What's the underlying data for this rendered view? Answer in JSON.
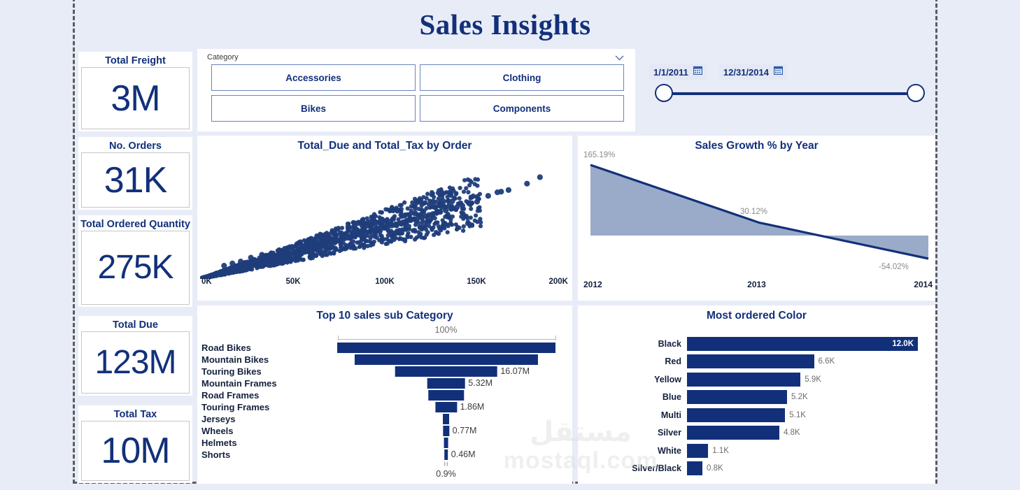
{
  "page": {
    "title": "Sales Insights",
    "background": "#e8ecf7",
    "accent": "#12307a",
    "area_fill": "#9aabc9"
  },
  "kpis": [
    {
      "title": "Total Freight",
      "value": "3M"
    },
    {
      "title": "No. Orders",
      "value": "31K"
    },
    {
      "title": "Total Ordered Quantity",
      "value": "275K"
    },
    {
      "title": "Total Due",
      "value": "123M"
    },
    {
      "title": "Total Tax",
      "value": "10M"
    }
  ],
  "category_slicer": {
    "label": "Category",
    "chevron": "chevron-down-icon",
    "items": [
      "Accessories",
      "Clothing",
      "Bikes",
      "Components"
    ]
  },
  "date_slicer": {
    "start": "1/1/2011",
    "end": "12/31/2014",
    "start_icon": "calendar-icon",
    "end_icon": "calendar-icon"
  },
  "watermark": {
    "arabic": "مستقل",
    "latin": "mostaql.com"
  },
  "chart_data": [
    {
      "id": "scatter",
      "type": "scatter",
      "title": "Total_Due and Total_Tax by Order",
      "xlabel": "",
      "ylabel": "",
      "xticks": [
        "0K",
        "50K",
        "100K",
        "150K",
        "200K"
      ],
      "xlim": [
        0,
        200000
      ],
      "ylim": [
        0,
        19000
      ],
      "grid": false,
      "legend": null,
      "series": [
        {
          "name": "Total_Tax",
          "color": "#1f3d7a",
          "points": [
            [
              1200,
              90
            ],
            [
              2200,
              180
            ],
            [
              3100,
              250
            ],
            [
              4200,
              340
            ],
            [
              5300,
              430
            ],
            [
              6100,
              500
            ],
            [
              7400,
              600
            ],
            [
              8600,
              700
            ],
            [
              9800,
              790
            ],
            [
              11000,
              880
            ],
            [
              12500,
              1000
            ],
            [
              13800,
              1110
            ],
            [
              15200,
              1220
            ],
            [
              16500,
              1320
            ],
            [
              18000,
              1440
            ],
            [
              19500,
              1560
            ],
            [
              21000,
              1680
            ],
            [
              22500,
              1800
            ],
            [
              24000,
              1920
            ],
            [
              25500,
              2040
            ],
            [
              27000,
              2160
            ],
            [
              28500,
              2280
            ],
            [
              30000,
              2400
            ],
            [
              31500,
              2520
            ],
            [
              33000,
              2640
            ],
            [
              34500,
              2760
            ],
            [
              36000,
              2880
            ],
            [
              37500,
              3000
            ],
            [
              39000,
              3120
            ],
            [
              40500,
              3240
            ],
            [
              42000,
              3360
            ],
            [
              43500,
              3480
            ],
            [
              45000,
              3600
            ],
            [
              46500,
              3720
            ],
            [
              48000,
              3840
            ],
            [
              49500,
              3960
            ],
            [
              51000,
              4080
            ],
            [
              52500,
              4200
            ],
            [
              54000,
              4320
            ],
            [
              55500,
              4440
            ],
            [
              57000,
              4560
            ],
            [
              58500,
              4680
            ],
            [
              60000,
              4800
            ],
            [
              62000,
              4960
            ],
            [
              64000,
              5120
            ],
            [
              66000,
              5280
            ],
            [
              68000,
              5440
            ],
            [
              70000,
              5600
            ],
            [
              72000,
              5760
            ],
            [
              74000,
              5920
            ],
            [
              76000,
              6080
            ],
            [
              78000,
              6240
            ],
            [
              80000,
              6400
            ],
            [
              82000,
              6560
            ],
            [
              84000,
              6720
            ],
            [
              86000,
              6880
            ],
            [
              88000,
              7040
            ],
            [
              90000,
              7200
            ],
            [
              92000,
              7360
            ],
            [
              94000,
              7520
            ],
            [
              96000,
              7680
            ],
            [
              98000,
              7840
            ],
            [
              100000,
              8000
            ],
            [
              102000,
              8160
            ],
            [
              104000,
              8320
            ],
            [
              106000,
              8480
            ],
            [
              108000,
              8640
            ],
            [
              110000,
              8800
            ],
            [
              112000,
              8960
            ],
            [
              114000,
              9120
            ],
            [
              116000,
              9280
            ],
            [
              118000,
              9440
            ],
            [
              120000,
              9600
            ],
            [
              122000,
              9760
            ],
            [
              124000,
              9920
            ],
            [
              126000,
              10080
            ],
            [
              128000,
              10240
            ],
            [
              130000,
              10400
            ],
            [
              133000,
              10640
            ],
            [
              136000,
              10880
            ],
            [
              139000,
              11120
            ],
            [
              142000,
              11360
            ],
            [
              146000,
              11680
            ],
            [
              150000,
              12000
            ],
            [
              156000,
              12900
            ],
            [
              161000,
              13450
            ],
            [
              163000,
              13550
            ],
            [
              167000,
              13800
            ],
            [
              177000,
              14800
            ],
            [
              184000,
              15800
            ],
            [
              13000,
              2050
            ],
            [
              17500,
              2400
            ],
            [
              22000,
              2700
            ],
            [
              27500,
              3300
            ],
            [
              33500,
              3750
            ],
            [
              36500,
              3200
            ],
            [
              43000,
              4350
            ],
            [
              47000,
              4550
            ],
            [
              52000,
              5100
            ],
            [
              57500,
              5350
            ],
            [
              62000,
              5700
            ],
            [
              68500,
              6500
            ],
            [
              73000,
              6300
            ],
            [
              79000,
              6900
            ],
            [
              85000,
              7600
            ],
            [
              90500,
              8250
            ],
            [
              95000,
              8500
            ],
            [
              99000,
              8900
            ],
            [
              104500,
              9300
            ],
            [
              110500,
              9800
            ],
            [
              116500,
              10200
            ],
            [
              121000,
              10500
            ],
            [
              126500,
              11400
            ],
            [
              131000,
              11150
            ],
            [
              136500,
              12050
            ],
            [
              141000,
              11750
            ],
            [
              145500,
              11800
            ]
          ]
        }
      ]
    },
    {
      "id": "sales-growth",
      "type": "area",
      "title": "Sales Growth % by Year",
      "xlabel": "",
      "ylabel": "",
      "categories": [
        "2012",
        "2013",
        "2014"
      ],
      "values": [
        165.19,
        30.12,
        -54.02
      ],
      "value_labels": [
        "165.19%",
        "30.12%",
        "-54.02%"
      ],
      "line_color": "#12307a",
      "fill_color": "#9aabc9",
      "grid": false,
      "ylim": [
        -54.02,
        165.19
      ]
    },
    {
      "id": "top10-subcategory",
      "type": "bar",
      "subtype": "funnel",
      "title": "Top 10 sales sub Category",
      "categories": [
        "Road Bikes",
        "Mountain Bikes",
        "Touring Bikes",
        "Mountain Frames",
        "Road Frames",
        "Touring Frames",
        "Jerseys",
        "Wheels",
        "Helmets",
        "Shorts"
      ],
      "values": [
        100,
        84,
        47,
        17.5,
        16.5,
        10,
        3.2,
        3.0,
        2.2,
        1.8
      ],
      "value_labels": [
        "",
        "",
        "16.07M",
        "5.32M",
        "",
        "1.86M",
        "",
        "0.77M",
        "",
        "0.46M"
      ],
      "top_axis_label": "100%",
      "bottom_axis_label": "0.9%",
      "bottom_axis_tick": "H",
      "bar_color": "#12307a"
    },
    {
      "id": "most-ordered-color",
      "type": "bar",
      "orientation": "horizontal",
      "title": "Most ordered Color",
      "categories": [
        "Black",
        "Red",
        "Yellow",
        "Blue",
        "Multi",
        "Silver",
        "White",
        "Silver/Black"
      ],
      "values": [
        12000,
        6600,
        5900,
        5200,
        5100,
        4800,
        1100,
        800
      ],
      "value_labels": [
        "12.0K",
        "6.6K",
        "5.9K",
        "5.2K",
        "5.1K",
        "4.8K",
        "1.1K",
        "0.8K"
      ],
      "xlim": [
        0,
        12000
      ],
      "bar_color": "#12307a",
      "grid": false
    }
  ]
}
